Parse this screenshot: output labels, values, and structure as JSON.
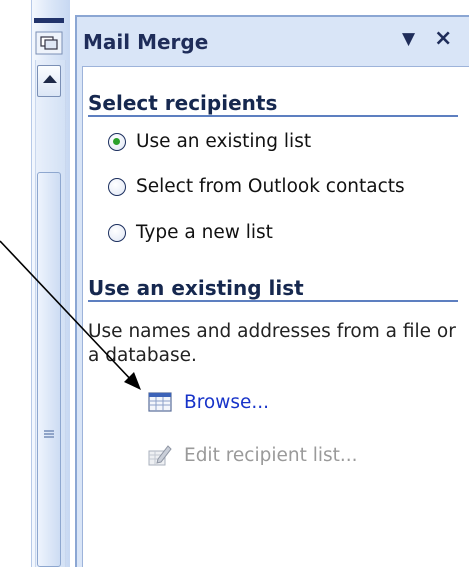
{
  "task_pane": {
    "title": "Mail Merge",
    "menu_icon": "dropdown-triangle-icon",
    "close_icon": "close-x-icon"
  },
  "select_recipients": {
    "heading": "Select recipients",
    "options": [
      {
        "label": "Use an existing list",
        "selected": true
      },
      {
        "label": "Select from Outlook contacts",
        "selected": false
      },
      {
        "label": "Type a new list",
        "selected": false
      }
    ]
  },
  "existing_list": {
    "heading": "Use an existing list",
    "description": "Use names and addresses from a file or a database.",
    "browse_label": "Browse...",
    "browse_icon": "table-icon",
    "edit_label": "Edit recipient list...",
    "edit_icon": "edit-list-icon",
    "edit_enabled": false
  },
  "colors": {
    "pane_background": "#d9e5f7",
    "heading_text": "#16284f",
    "link_text": "#1733c9",
    "disabled_text": "#9a9a9a",
    "radio_checked": "#2ba12b"
  }
}
